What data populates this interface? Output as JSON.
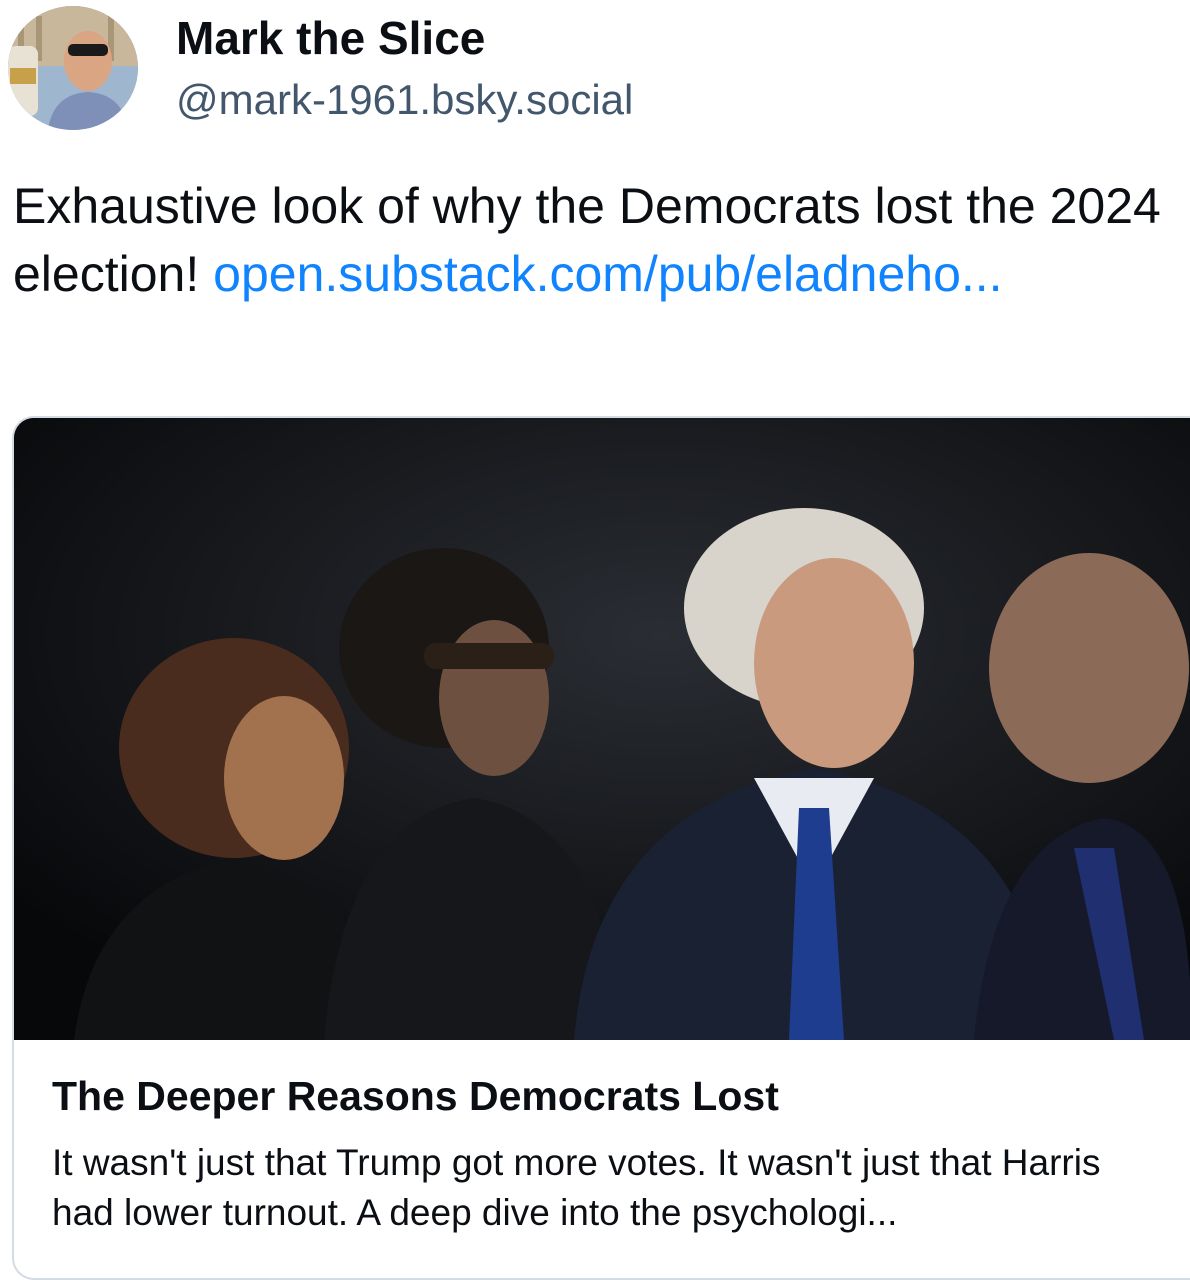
{
  "author": {
    "display_name": "Mark the Slice",
    "handle": "@mark-1961.bsky.social",
    "avatar_icon": "user-avatar"
  },
  "post": {
    "text": "Exhaustive look of why the Democrats lost the 2024 election!",
    "link_text": "open.substack.com/pub/eladneho..."
  },
  "link_card": {
    "title": "The Deeper Reasons Democrats Lost",
    "description": "It wasn't just that Trump got more votes. It wasn't just that Harris had lower turnout. A deep dive into the psychologi..."
  },
  "colors": {
    "link": "#1083fe",
    "handle": "#42576c",
    "text": "#0b0f14",
    "card_border": "#d4dbe2"
  }
}
